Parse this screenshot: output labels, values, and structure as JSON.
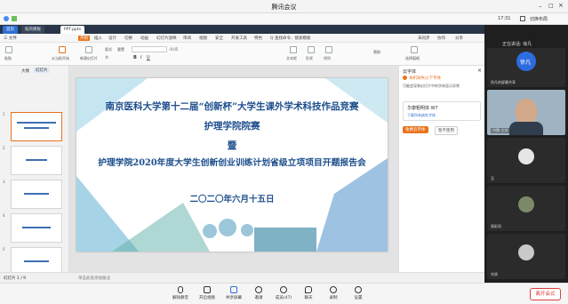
{
  "meeting": {
    "title": "腾讯会议",
    "time": "17:31",
    "switch_layout": "切换布局",
    "speaking_label": "正在讲话: 徐凡",
    "leave_label": "离开会议"
  },
  "wps": {
    "tabs": [
      "首页",
      "稻壳模板",
      "PPT.pptx"
    ],
    "menu": [
      "三 文件",
      "开始",
      "插入",
      "设计",
      "切换",
      "动画",
      "幻灯片放映",
      "审阅",
      "视图",
      "安全",
      "开发工具",
      "特色",
      "Q 查找命令、搜索模板",
      "未同步",
      "协作",
      "分享"
    ],
    "ribbon_labels": [
      "粘贴",
      "从当前开始",
      "新建幻灯片",
      "版式",
      "节",
      "重置",
      "-0.05",
      "文本框",
      "形状",
      "排列",
      "替换",
      "选择窗格"
    ],
    "panel_tabs": [
      "大纲",
      "幻灯片"
    ],
    "thumb_numbers": [
      "1",
      "2",
      "3",
      "4",
      "5",
      "6",
      "7"
    ],
    "thumb_captions": [
      "",
      "",
      "",
      "",
      "",
      "",
      ""
    ],
    "statusbar": "单击此处添加备注",
    "slide_info": "幻灯片 1 / 9",
    "right_panel": {
      "title": "云字体",
      "notice": "本机缺失以下字体",
      "desc": "可能会导致幻灯片中的字体显示异常",
      "font_item": "华康粗明体 W7",
      "download": "下载所有缺失字体",
      "btn_primary": "免费云字体",
      "btn_secondary": "暂不使用"
    }
  },
  "slide": {
    "line1": "南京医科大学第十二届“创新杯”大学生课外学术科技作品竞赛",
    "line2": "护理学院院赛",
    "line3": "暨",
    "line4": "护理学院2020年度大学生创新创业训练计划省级立项项目开题报告会",
    "date": "二〇二〇年六月十五日"
  },
  "participants": {
    "speaker_avatar_text": "徐凡",
    "tiles": [
      "徐凡的屏幕共享",
      "何腾-主持",
      "丑",
      "周彩凤",
      "刘贤"
    ]
  },
  "toolbar": {
    "items": [
      "解除静音",
      "开启视频",
      "共享屏幕",
      "邀请",
      "成员(47)",
      "聊天",
      "录制",
      "设置"
    ]
  },
  "colors": {
    "accent": "#e8731c",
    "slide_blue": "#1c4e8c",
    "leave_red": "#e23c3c"
  }
}
